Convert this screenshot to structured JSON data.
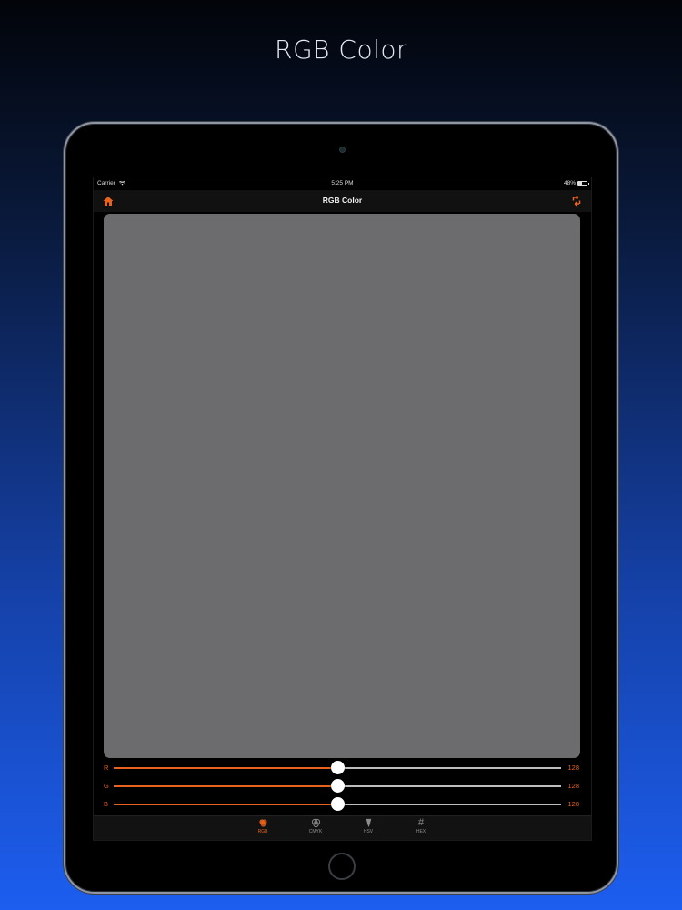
{
  "promo": {
    "title": "RGB Color"
  },
  "status_bar": {
    "carrier": "Carrier",
    "time": "5:25 PM",
    "battery": "48%"
  },
  "nav": {
    "title": "RGB Color"
  },
  "colors": {
    "accent": "#e8641e",
    "preview": "#6c6b6d"
  },
  "sliders": [
    {
      "label": "R",
      "value": "128",
      "fraction": 0.502
    },
    {
      "label": "G",
      "value": "128",
      "fraction": 0.502
    },
    {
      "label": "B",
      "value": "128",
      "fraction": 0.502
    }
  ],
  "tabs": [
    {
      "label": "RGB",
      "icon": "rgb-circles-icon",
      "active": true
    },
    {
      "label": "CMYK",
      "icon": "cmyk-circles-icon",
      "active": false
    },
    {
      "label": "HSV",
      "icon": "dropper-icon",
      "active": false
    },
    {
      "label": "HEX",
      "icon": "hash-icon",
      "active": false
    }
  ]
}
